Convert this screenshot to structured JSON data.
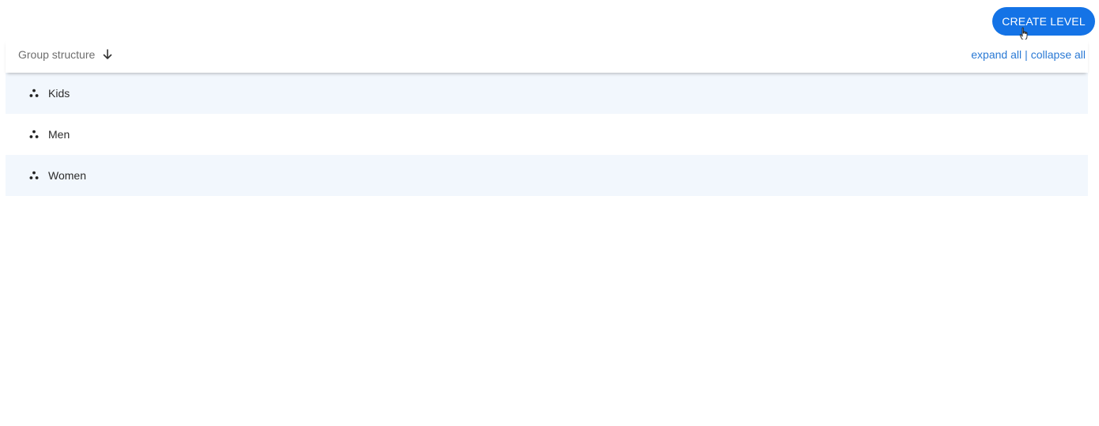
{
  "toolbar": {
    "create_label": "CREATE LEVEL"
  },
  "header": {
    "sort_label": "Group structure",
    "sort_icon": "arrow-down-icon",
    "expand_label": "expand all",
    "separator": "|",
    "collapse_label": "collapse all"
  },
  "groups": [
    {
      "label": "Kids",
      "icon": "group-icon"
    },
    {
      "label": "Men",
      "icon": "group-icon"
    },
    {
      "label": "Women",
      "icon": "group-icon"
    }
  ],
  "colors": {
    "accent": "#1473e6",
    "link": "#2a79d4",
    "row_alt": "#f2f7fd"
  }
}
